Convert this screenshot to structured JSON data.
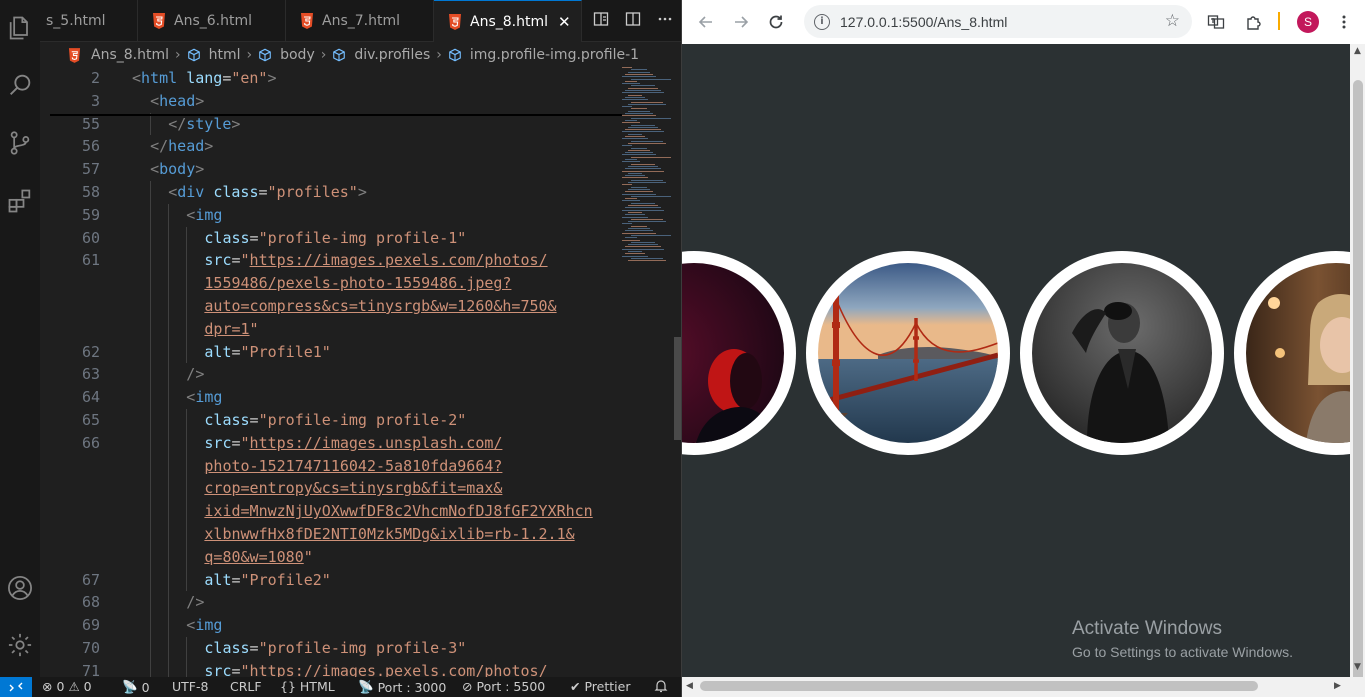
{
  "editor": {
    "tabs": [
      {
        "label": "s_5.html"
      },
      {
        "label": "Ans_6.html"
      },
      {
        "label": "Ans_7.html"
      },
      {
        "label": "Ans_8.html",
        "active": true
      }
    ],
    "close_glyph": "✕",
    "breadcrumb": [
      "Ans_8.html",
      "html",
      "body",
      "div.profiles",
      "img.profile-img.profile-1"
    ],
    "code_lines": [
      {
        "n": "2",
        "indent": 0,
        "parts": [
          [
            "brk",
            "<"
          ],
          [
            "tag",
            "html"
          ],
          [
            "txt",
            " "
          ],
          [
            "attr",
            "lang"
          ],
          [
            "txt",
            "="
          ],
          [
            "str",
            "\"en\""
          ],
          [
            "brk",
            ">"
          ]
        ]
      },
      {
        "n": "3",
        "indent": 1,
        "parts": [
          [
            "brk",
            "<"
          ],
          [
            "tag",
            "head"
          ],
          [
            "brk",
            ">"
          ]
        ]
      },
      {
        "n": "55",
        "indent": 2,
        "parts": [
          [
            "brk",
            "</"
          ],
          [
            "tag",
            "style"
          ],
          [
            "brk",
            ">"
          ]
        ]
      },
      {
        "n": "56",
        "indent": 1,
        "parts": [
          [
            "brk",
            "</"
          ],
          [
            "tag",
            "head"
          ],
          [
            "brk",
            ">"
          ]
        ]
      },
      {
        "n": "57",
        "indent": 1,
        "parts": [
          [
            "brk",
            "<"
          ],
          [
            "tag",
            "body"
          ],
          [
            "brk",
            ">"
          ]
        ]
      },
      {
        "n": "58",
        "indent": 2,
        "parts": [
          [
            "brk",
            "<"
          ],
          [
            "tag",
            "div"
          ],
          [
            "txt",
            " "
          ],
          [
            "attr",
            "class"
          ],
          [
            "txt",
            "="
          ],
          [
            "str",
            "\"profiles\""
          ],
          [
            "brk",
            ">"
          ]
        ]
      },
      {
        "n": "59",
        "indent": 3,
        "parts": [
          [
            "brk",
            "<"
          ],
          [
            "tag",
            "img"
          ]
        ]
      },
      {
        "n": "60",
        "indent": 4,
        "parts": [
          [
            "attr",
            "class"
          ],
          [
            "txt",
            "="
          ],
          [
            "str",
            "\"profile-img profile-1\""
          ]
        ]
      },
      {
        "n": "61",
        "indent": 4,
        "parts": [
          [
            "attr",
            "src"
          ],
          [
            "txt",
            "="
          ],
          [
            "str",
            "\""
          ],
          [
            "url",
            "https://images.pexels.com/photos/"
          ]
        ]
      },
      {
        "n": "",
        "indent": 4,
        "parts": [
          [
            "url",
            "1559486/pexels-photo-1559486.jpeg?"
          ]
        ]
      },
      {
        "n": "",
        "indent": 4,
        "parts": [
          [
            "url",
            "auto=compress&cs=tinysrgb&w=1260&h=750&"
          ]
        ]
      },
      {
        "n": "",
        "indent": 4,
        "parts": [
          [
            "url",
            "dpr=1"
          ],
          [
            "str",
            "\""
          ]
        ]
      },
      {
        "n": "62",
        "indent": 4,
        "parts": [
          [
            "attr",
            "alt"
          ],
          [
            "txt",
            "="
          ],
          [
            "str",
            "\"Profile1\""
          ]
        ]
      },
      {
        "n": "63",
        "indent": 3,
        "parts": [
          [
            "brk",
            "/>"
          ]
        ]
      },
      {
        "n": "64",
        "indent": 3,
        "parts": [
          [
            "brk",
            "<"
          ],
          [
            "tag",
            "img"
          ]
        ]
      },
      {
        "n": "65",
        "indent": 4,
        "parts": [
          [
            "attr",
            "class"
          ],
          [
            "txt",
            "="
          ],
          [
            "str",
            "\"profile-img profile-2\""
          ]
        ]
      },
      {
        "n": "66",
        "indent": 4,
        "parts": [
          [
            "attr",
            "src"
          ],
          [
            "txt",
            "="
          ],
          [
            "str",
            "\""
          ],
          [
            "url",
            "https://images.unsplash.com/"
          ]
        ]
      },
      {
        "n": "",
        "indent": 4,
        "parts": [
          [
            "url",
            "photo-1521747116042-5a810fda9664?"
          ]
        ]
      },
      {
        "n": "",
        "indent": 4,
        "parts": [
          [
            "url",
            "crop=entropy&cs=tinysrgb&fit=max&"
          ]
        ]
      },
      {
        "n": "",
        "indent": 4,
        "parts": [
          [
            "url",
            "ixid=MnwzNjUyOXwwfDF8c2VhcmNofDJ8fGF2YXRhcn"
          ]
        ]
      },
      {
        "n": "",
        "indent": 4,
        "parts": [
          [
            "url",
            "xlbnwwfHx8fDE2NTI0Mzk5MDg&ixlib=rb-1.2.1&"
          ]
        ]
      },
      {
        "n": "",
        "indent": 4,
        "parts": [
          [
            "url",
            "q=80&w=1080"
          ],
          [
            "str",
            "\""
          ]
        ]
      },
      {
        "n": "67",
        "indent": 4,
        "parts": [
          [
            "attr",
            "alt"
          ],
          [
            "txt",
            "="
          ],
          [
            "str",
            "\"Profile2\""
          ]
        ]
      },
      {
        "n": "68",
        "indent": 3,
        "parts": [
          [
            "brk",
            "/>"
          ]
        ]
      },
      {
        "n": "69",
        "indent": 3,
        "parts": [
          [
            "brk",
            "<"
          ],
          [
            "tag",
            "img"
          ]
        ]
      },
      {
        "n": "70",
        "indent": 4,
        "parts": [
          [
            "attr",
            "class"
          ],
          [
            "txt",
            "="
          ],
          [
            "str",
            "\"profile-img profile-3\""
          ]
        ]
      },
      {
        "n": "71",
        "indent": 4,
        "parts": [
          [
            "attr",
            "src"
          ],
          [
            "txt",
            "="
          ],
          [
            "str",
            "\""
          ],
          [
            "url",
            "https://images.pexels.com/photos/"
          ]
        ]
      }
    ],
    "status": {
      "errors": "0",
      "warnings": "0",
      "ports": "0",
      "encoding": "UTF-8",
      "eol": "CRLF",
      "language": "HTML",
      "port": "Port : 3000",
      "port2": "Port : 5500",
      "prettier": "Prettier"
    }
  },
  "browser": {
    "url": "127.0.0.1:5500/Ans_8.html",
    "profile_initial": "S",
    "watermark": {
      "title": "Activate Windows",
      "subtitle": "Go to Settings to activate Windows."
    }
  },
  "colors": {
    "vscode_bg": "#1f1f1f",
    "accent": "#0078d4",
    "page_bg": "#2b3133",
    "profile_ring": "#ffffff",
    "avatar": "#c2185b"
  }
}
